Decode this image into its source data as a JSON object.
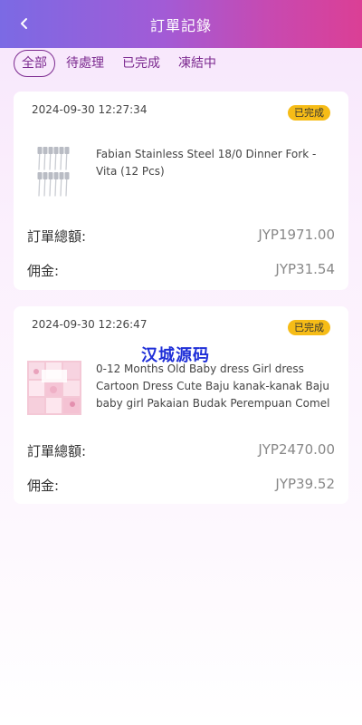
{
  "header": {
    "title": "訂單記錄"
  },
  "tabs": [
    {
      "label": "全部",
      "active": true
    },
    {
      "label": "待處理",
      "active": false
    },
    {
      "label": "已完成",
      "active": false
    },
    {
      "label": "凍結中",
      "active": false
    }
  ],
  "orders": [
    {
      "time": "2024-09-30 12:27:34",
      "status": "已完成",
      "product_name": "Fabian Stainless Steel 18/0 Dinner Fork - Vita (12 Pcs)",
      "total_label": "訂單總額:",
      "total_value": "JYP1971.00",
      "commission_label": "佣金:",
      "commission_value": "JYP31.54"
    },
    {
      "time": "2024-09-30 12:26:47",
      "status": "已完成",
      "product_name": "0-12 Months Old Baby dress Girl dress Cartoon Dress Cute Baju kanak-kanak Baju baby girl Pakaian Budak Perempuan Comel",
      "total_label": "訂單總額:",
      "total_value": "JYP2470.00",
      "commission_label": "佣金:",
      "commission_value": "JYP39.52"
    }
  ],
  "watermark": "汉城源码",
  "colors": {
    "header_start": "#7b6ae4",
    "header_end": "#db3f95",
    "tab_text": "#7c2a90",
    "badge": "#f6bc17",
    "watermark": "#1f2fd8"
  }
}
